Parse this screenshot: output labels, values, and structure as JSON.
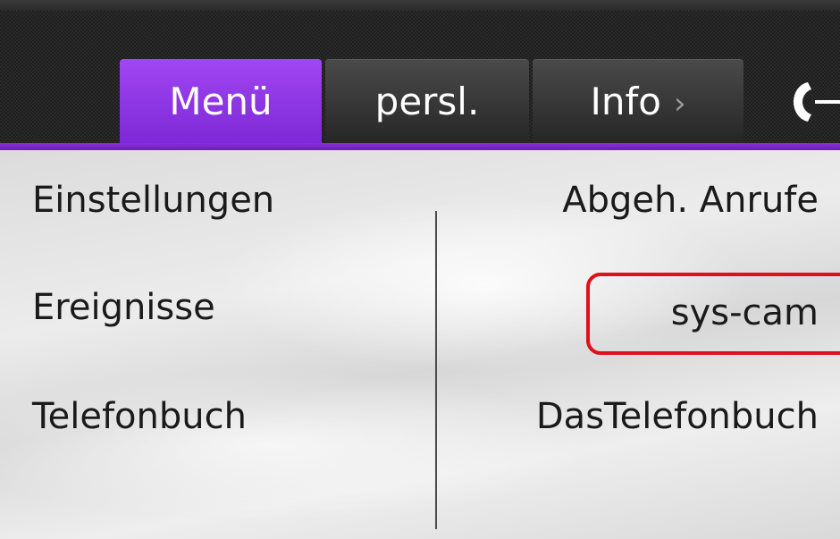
{
  "tabs": [
    {
      "label": "Menü",
      "active": true
    },
    {
      "label": "persl.",
      "active": false
    },
    {
      "label": "Info",
      "active": false,
      "chevron": "›"
    }
  ],
  "header": {
    "call_icon": "phone-handset-icon",
    "accent_color": "#8a2ee0"
  },
  "left_menu": {
    "items": [
      {
        "label": "Einstellungen"
      },
      {
        "label": "Ereignisse"
      },
      {
        "label": "Telefonbuch"
      }
    ]
  },
  "right_menu": {
    "items": [
      {
        "label": "Abgeh. Anrufe"
      },
      {
        "label": "sys-cam",
        "highlighted": true
      },
      {
        "label": "DasTelefonbuch"
      }
    ]
  },
  "highlight": {
    "color": "#e0101a"
  }
}
